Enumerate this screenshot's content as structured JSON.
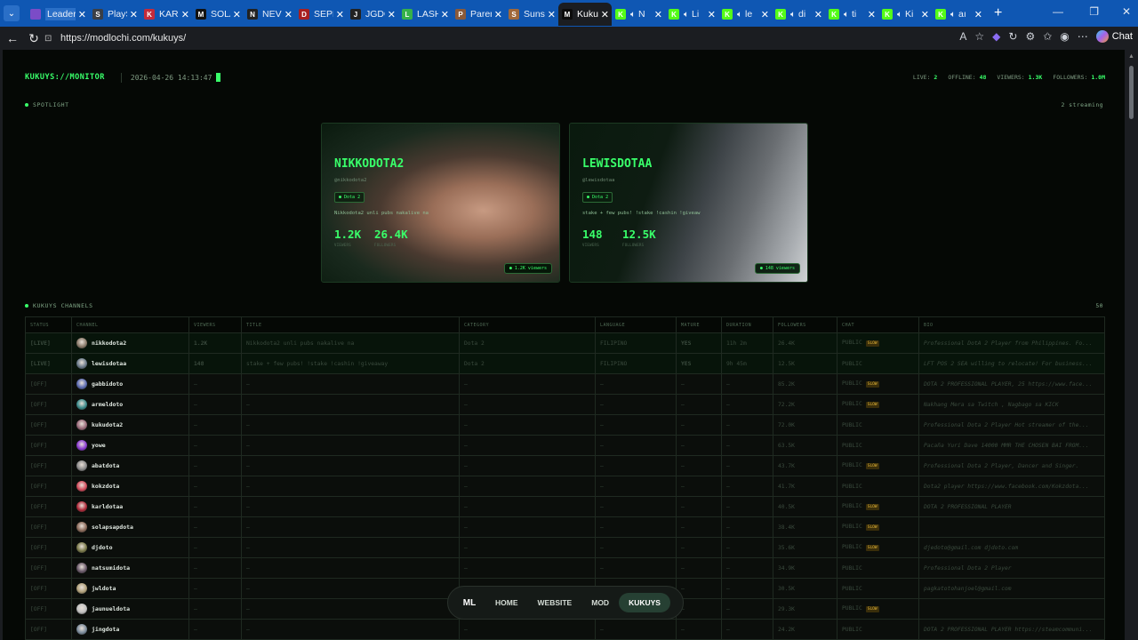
{
  "browser": {
    "tabs": [
      {
        "label": "Leaderboard",
        "fav_color": "#7b4cc7",
        "fav_glyph": "",
        "audio": false,
        "active": false
      },
      {
        "label": "PlaySt",
        "fav_color": "#3b3f46",
        "fav_glyph": "S",
        "audio": false,
        "active": false
      },
      {
        "label": "KARL",
        "fav_color": "#c42b3b",
        "fav_glyph": "K",
        "audio": false,
        "active": false
      },
      {
        "label": "SOLAI",
        "fav_color": "#111",
        "fav_glyph": "M",
        "audio": false,
        "active": false
      },
      {
        "label": "NEVER",
        "fav_color": "#222",
        "fav_glyph": "N",
        "audio": false,
        "active": false
      },
      {
        "label": "SEPDO",
        "fav_color": "#a81f1f",
        "fav_glyph": "D",
        "audio": false,
        "active": false
      },
      {
        "label": "JGDOT",
        "fav_color": "#222",
        "fav_glyph": "J",
        "audio": false,
        "active": false
      },
      {
        "label": "LASH",
        "fav_color": "#36b14a",
        "fav_glyph": "L",
        "audio": false,
        "active": false
      },
      {
        "label": "Parent",
        "fav_color": "#8a5a3a",
        "fav_glyph": "P",
        "audio": false,
        "active": false
      },
      {
        "label": "Sunsh",
        "fav_color": "#a0683a",
        "fav_glyph": "S",
        "audio": false,
        "active": false
      },
      {
        "label": "Kukuy",
        "fav_color": "#0b0b0b",
        "fav_glyph": "M",
        "audio": false,
        "active": true
      },
      {
        "label": "N",
        "fav_color": "#53fc18",
        "fav_glyph": "K",
        "audio": true,
        "active": false
      },
      {
        "label": "Li",
        "fav_color": "#53fc18",
        "fav_glyph": "K",
        "audio": true,
        "active": false
      },
      {
        "label": "le",
        "fav_color": "#53fc18",
        "fav_glyph": "K",
        "audio": true,
        "active": false
      },
      {
        "label": "di",
        "fav_color": "#53fc18",
        "fav_glyph": "K",
        "audio": true,
        "active": false
      },
      {
        "label": "ti",
        "fav_color": "#53fc18",
        "fav_glyph": "K",
        "audio": true,
        "active": false
      },
      {
        "label": "Ki",
        "fav_color": "#53fc18",
        "fav_glyph": "K",
        "audio": true,
        "active": false
      },
      {
        "label": "aı",
        "fav_color": "#53fc18",
        "fav_glyph": "K",
        "audio": true,
        "active": false
      }
    ],
    "url": "https://modlochi.com/kukuys/",
    "chat_label": "Chat"
  },
  "monitor": {
    "brand": "KUKUYS://MONITOR",
    "datetime": "2026-04-26 14:13:47",
    "stats": [
      {
        "label": "LIVE:",
        "value": "2"
      },
      {
        "label": "OFFLINE:",
        "value": "48"
      },
      {
        "label": "VIEWERS:",
        "value": "1.3K"
      },
      {
        "label": "FOLLOWERS:",
        "value": "1.0M"
      }
    ]
  },
  "spotlight": {
    "label": "SPOTLIGHT",
    "right": "2 streaming",
    "cards": [
      {
        "name": "NIKKODOTA2",
        "handle": "@nikkodota2",
        "category": "Dota 2",
        "title": "Nikkodota2 unli pubs nakalive na",
        "viewers": "1.2K",
        "viewers_label": "VIEWERS",
        "followers": "26.4K",
        "followers_label": "FOLLOWERS",
        "badge": "1.2K viewers"
      },
      {
        "name": "LEWISDOTAA",
        "handle": "@lewisdotaa",
        "category": "Dota 2",
        "title": "stake + few pubs! !stake !cashin !giveaw",
        "viewers": "148",
        "viewers_label": "VIEWERS",
        "followers": "12.5K",
        "followers_label": "FOLLOWERS",
        "badge": "148 viewers"
      }
    ]
  },
  "channels": {
    "label": "KUKUYS CHANNELS",
    "count": "50",
    "headers": [
      "STATUS",
      "CHANNEL",
      "VIEWERS",
      "TITLE",
      "CATEGORY",
      "LANGUAGE",
      "MATURE",
      "DURATION",
      "FOLLOWERS",
      "CHAT",
      "BIO"
    ],
    "rows": [
      {
        "status": "[LIVE]",
        "live": true,
        "channel": "nikkodota2",
        "avatar": "#8a7a6a",
        "viewers": "1.2K",
        "title": "Nikkodota2 unli pubs nakalive na",
        "category": "Dota 2",
        "language": "FILIPINO",
        "mature": "YES",
        "duration": "11h 2m",
        "followers": "26.4K",
        "chat": "PUBLIC",
        "slow": true,
        "bio": "Professional DotA 2 Player from Philippines. Fo..."
      },
      {
        "status": "[LIVE]",
        "live": true,
        "channel": "lewisdotaa",
        "avatar": "#6a7a8a",
        "viewers": "148",
        "title": "stake + few pubs! !stake !cashin !giveaway",
        "category": "Dota 2",
        "language": "FILIPINO",
        "mature": "YES",
        "duration": "9h 45m",
        "followers": "12.5K",
        "chat": "PUBLIC",
        "slow": false,
        "bio": "LFT POS 2 SEA willing to relocate! For business..."
      },
      {
        "status": "[OFF]",
        "live": false,
        "channel": "gabbidoto",
        "avatar": "#5a6ab0",
        "viewers": "—",
        "title": "—",
        "category": "—",
        "language": "—",
        "mature": "—",
        "duration": "—",
        "followers": "85.2K",
        "chat": "PUBLIC",
        "slow": true,
        "bio": "DOTA 2 PROFESSIONAL PLAYER, 25 https://www.face..."
      },
      {
        "status": "[OFF]",
        "live": false,
        "channel": "armeldoto",
        "avatar": "#3a8a8a",
        "viewers": "—",
        "title": "—",
        "category": "—",
        "language": "—",
        "mature": "—",
        "duration": "—",
        "followers": "72.2K",
        "chat": "PUBLIC",
        "slow": true,
        "bio": "Nakhang Mera sa Twitch , Nagbago sa KICK"
      },
      {
        "status": "[OFF]",
        "live": false,
        "channel": "kukudota2",
        "avatar": "#9a6a7a",
        "viewers": "—",
        "title": "—",
        "category": "—",
        "language": "—",
        "mature": "—",
        "duration": "—",
        "followers": "72.0K",
        "chat": "PUBLIC",
        "slow": false,
        "bio": "Professional Dota 2 Player Hot streamer of the..."
      },
      {
        "status": "[OFF]",
        "live": false,
        "channel": "yowe",
        "avatar": "#8a3ad0",
        "viewers": "—",
        "title": "—",
        "category": "—",
        "language": "—",
        "mature": "—",
        "duration": "—",
        "followers": "63.5K",
        "chat": "PUBLIC",
        "slow": false,
        "bio": "Pacaña Yuri Dave 14000 MMR THE CHOSEN BAI FROM..."
      },
      {
        "status": "[OFF]",
        "live": false,
        "channel": "abatdota",
        "avatar": "#8a8a8a",
        "viewers": "—",
        "title": "—",
        "category": "—",
        "language": "—",
        "mature": "—",
        "duration": "—",
        "followers": "43.7K",
        "chat": "PUBLIC",
        "slow": true,
        "bio": "Professional Dota 2 Player, Dancer and Singer."
      },
      {
        "status": "[OFF]",
        "live": false,
        "channel": "kokzdota",
        "avatar": "#d04a5a",
        "viewers": "—",
        "title": "—",
        "category": "—",
        "language": "—",
        "mature": "—",
        "duration": "—",
        "followers": "41.7K",
        "chat": "PUBLIC",
        "slow": false,
        "bio": "Dota2 player https://www.facebook.com/Kokzdota..."
      },
      {
        "status": "[OFF]",
        "live": false,
        "channel": "karldotaa",
        "avatar": "#b02a3a",
        "viewers": "—",
        "title": "—",
        "category": "—",
        "language": "—",
        "mature": "—",
        "duration": "—",
        "followers": "40.5K",
        "chat": "PUBLIC",
        "slow": true,
        "bio": "DOTA 2 PROFESSIONAL PLAYER"
      },
      {
        "status": "[OFF]",
        "live": false,
        "channel": "solapsapdota",
        "avatar": "#8a6a5a",
        "viewers": "—",
        "title": "—",
        "category": "—",
        "language": "—",
        "mature": "—",
        "duration": "—",
        "followers": "38.4K",
        "chat": "PUBLIC",
        "slow": true,
        "bio": ""
      },
      {
        "status": "[OFF]",
        "live": false,
        "channel": "djdoto",
        "avatar": "#7a7a4a",
        "viewers": "—",
        "title": "—",
        "category": "—",
        "language": "—",
        "mature": "—",
        "duration": "—",
        "followers": "35.6K",
        "chat": "PUBLIC",
        "slow": true,
        "bio": "djedoto@gmail.com djdoto.com"
      },
      {
        "status": "[OFF]",
        "live": false,
        "channel": "natsumidota",
        "avatar": "#6a5a6a",
        "viewers": "—",
        "title": "—",
        "category": "—",
        "language": "—",
        "mature": "—",
        "duration": "—",
        "followers": "34.9K",
        "chat": "PUBLIC",
        "slow": false,
        "bio": "Professional Dota 2 Player"
      },
      {
        "status": "[OFF]",
        "live": false,
        "channel": "jwldota",
        "avatar": "#b0a07a",
        "viewers": "—",
        "title": "—",
        "category": "—",
        "language": "—",
        "mature": "—",
        "duration": "—",
        "followers": "30.5K",
        "chat": "PUBLIC",
        "slow": false,
        "bio": "pagkatotohanjoel@gmail.com"
      },
      {
        "status": "[OFF]",
        "live": false,
        "channel": "jaunueldota",
        "avatar": "#c0c0c0",
        "viewers": "—",
        "title": "—",
        "category": "—",
        "language": "—",
        "mature": "—",
        "duration": "—",
        "followers": "29.3K",
        "chat": "PUBLIC",
        "slow": true,
        "bio": ""
      },
      {
        "status": "[OFF]",
        "live": false,
        "channel": "jingdota",
        "avatar": "#7a8a9a",
        "viewers": "—",
        "title": "—",
        "category": "—",
        "language": "—",
        "mature": "—",
        "duration": "—",
        "followers": "24.2K",
        "chat": "PUBLIC",
        "slow": false,
        "bio": "DOTA 2 PROFESSIONAL PLAYER https://steamcommuni..."
      }
    ]
  },
  "bottom_nav": {
    "logo": "ML",
    "items": [
      {
        "label": "HOME",
        "active": false
      },
      {
        "label": "WEBSITE",
        "active": false
      },
      {
        "label": "MOD",
        "active": false
      },
      {
        "label": "KUKUYS",
        "active": true
      }
    ]
  },
  "colors": {
    "accent": "#39ff6a",
    "mature": "#ff5454",
    "slow": "#e1b338",
    "tabbar": "#0f57b3"
  }
}
